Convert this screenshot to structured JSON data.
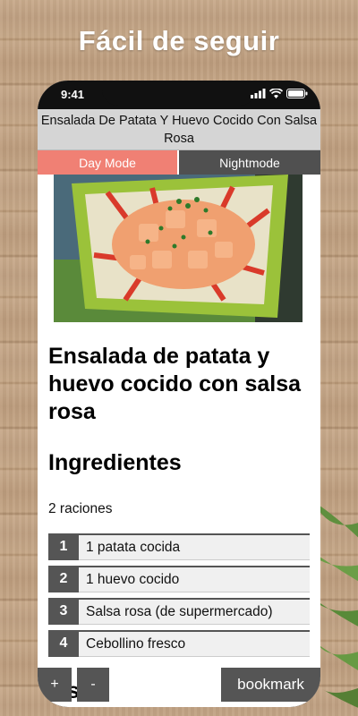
{
  "banner": {
    "title": "Fácil de seguir"
  },
  "status_bar": {
    "time": "9:41"
  },
  "app": {
    "title": "Ensalada De Patata Y Huevo Cocido Con Salsa Rosa",
    "modes": {
      "day": "Day Mode",
      "night": "Nightmode"
    }
  },
  "recipe": {
    "title": "Ensalada de patata y huevo cocido con salsa rosa",
    "ingredients_heading": "Ingredientes",
    "servings": "2 raciones",
    "ingredients": [
      {
        "num": "1",
        "text": "1 patata cocida"
      },
      {
        "num": "2",
        "text": "1 huevo cocido"
      },
      {
        "num": "3",
        "text": "Salsa rosa (de supermercado)"
      },
      {
        "num": "4",
        "text": "Cebollino fresco"
      }
    ],
    "next_heading_partial": "...s"
  },
  "controls": {
    "plus": "+",
    "minus": "-",
    "bookmark": "bookmark"
  },
  "colors": {
    "day_mode": "#f08074",
    "night_mode": "#505050",
    "number_badge": "#555555"
  }
}
